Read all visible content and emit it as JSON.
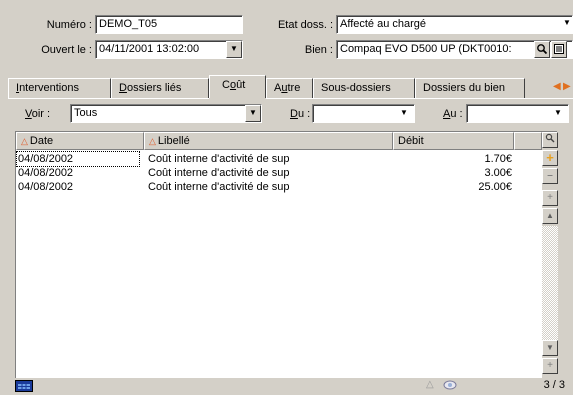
{
  "header": {
    "numero_label": "Numéro :",
    "numero_value": "DEMO_T05",
    "ouvert_label": "Ouvert le :",
    "ouvert_value": "04/11/2001 13:02:00",
    "etat_label": "Etat doss. :",
    "etat_value": "Affecté au chargé",
    "bien_label": "Bien :",
    "bien_value": "Compaq EVO D500 UP (DKT0010:"
  },
  "tabs": [
    {
      "label_pre": "",
      "label_u": "I",
      "label_post": "nterventions"
    },
    {
      "label_pre": "",
      "label_u": "D",
      "label_post": "ossiers liés"
    },
    {
      "label_pre": "C",
      "label_u": "o",
      "label_post": "ût"
    },
    {
      "label_pre": "A",
      "label_u": "u",
      "label_post": "tre"
    },
    {
      "label_pre": "Sous-dossiers",
      "label_u": "",
      "label_post": ""
    },
    {
      "label_pre": "Dossiers du bien",
      "label_u": "",
      "label_post": ""
    }
  ],
  "filters": {
    "voir_u": "V",
    "voir_rest": "oir :",
    "voir_value": "Tous",
    "du_u": "D",
    "du_rest": "u :",
    "du_value": "",
    "au_u": "A",
    "au_rest": "u :",
    "au_value": ""
  },
  "table": {
    "columns": [
      "Date",
      "Libellé",
      "Débit"
    ],
    "rows": [
      {
        "date": "04/08/2002",
        "libelle": "Coût interne d'activité de sup",
        "debit": "1.70€"
      },
      {
        "date": "04/08/2002",
        "libelle": "Coût interne d'activité de sup",
        "debit": "3.00€"
      },
      {
        "date": "04/08/2002",
        "libelle": "Coût interne d'activité de sup",
        "debit": "25.00€"
      }
    ]
  },
  "status": {
    "counter": "3 / 3"
  },
  "colors": {
    "background": "#d4d0c8",
    "sort_indicator": "#e05a2a",
    "accent_plus": "#e8a020",
    "nav_arrow": "#e07020"
  },
  "icons": [
    "search-icon",
    "details-icon",
    "dropdown-arrow-icon",
    "tab-scroll-left-icon",
    "tab-scroll-right-icon",
    "magnifier-icon",
    "add-icon",
    "remove-icon",
    "expand-icon",
    "scroll-up-icon",
    "scroll-down-icon",
    "grid-menu-icon",
    "warning-icon",
    "refresh-icon"
  ]
}
